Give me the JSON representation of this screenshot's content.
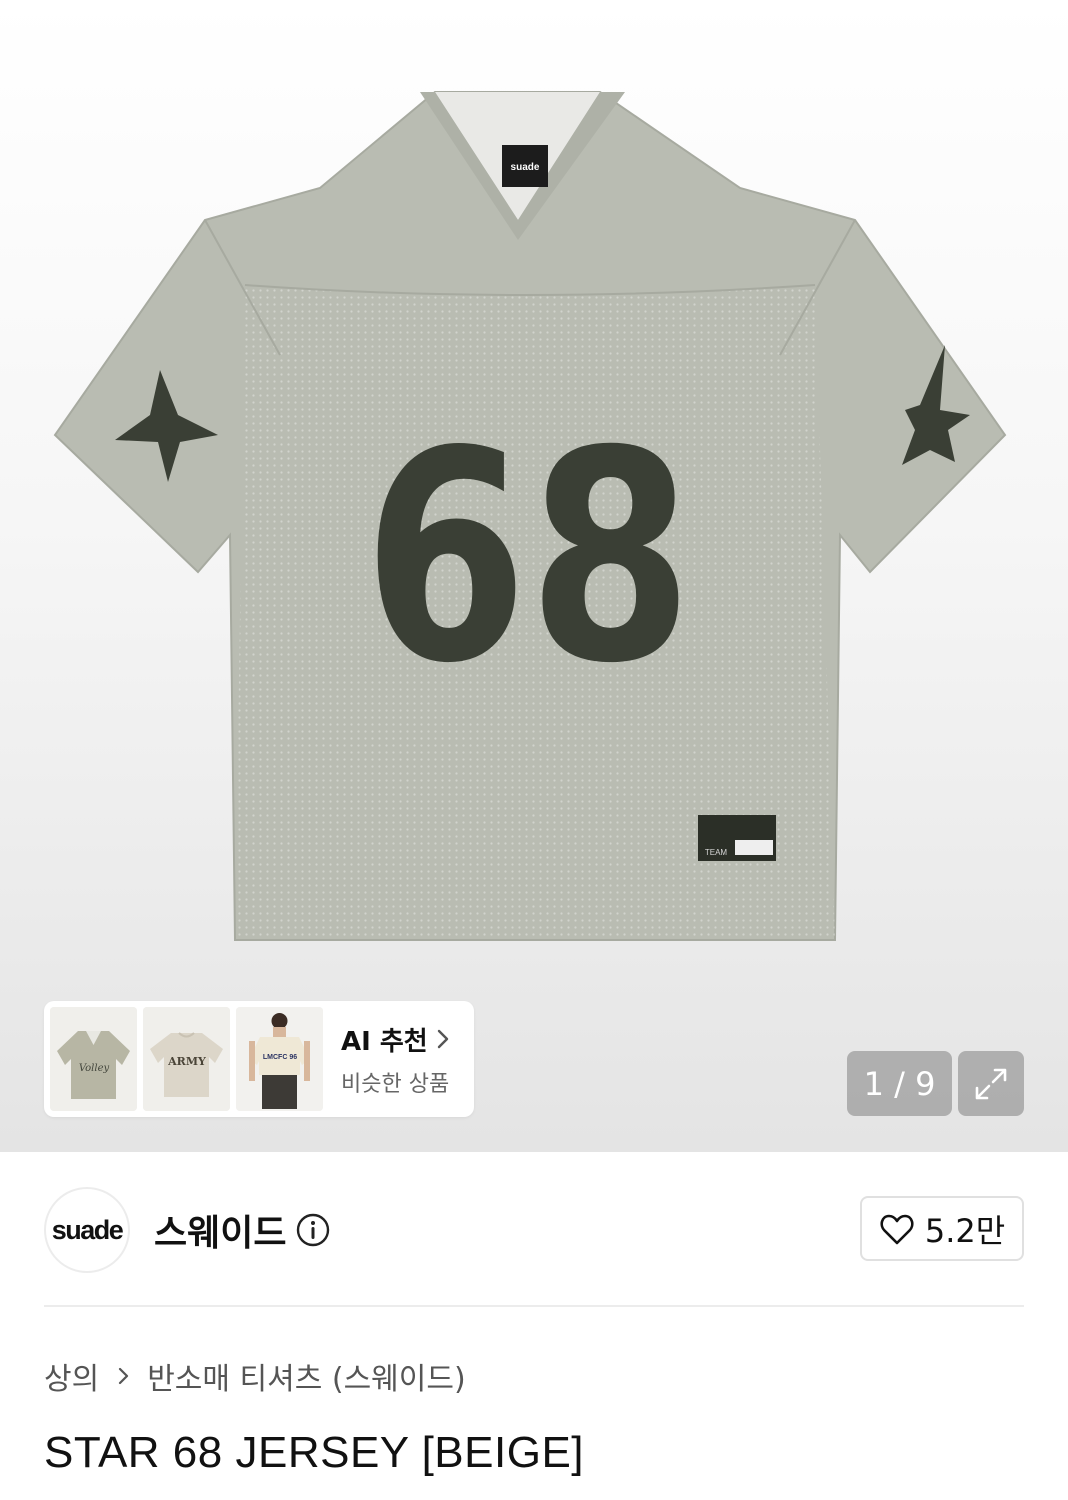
{
  "gallery": {
    "image_name": "jersey-image",
    "jersey_number": "68",
    "collar_label": "suade",
    "hem_label": "TEAM",
    "counter": "1 / 9",
    "thumbnails": [
      {
        "name": "thumbnail-1",
        "text": "Volley"
      },
      {
        "name": "thumbnail-2",
        "text": "ARMY"
      },
      {
        "name": "thumbnail-3",
        "text": "LMCFC 96"
      }
    ],
    "ai_recommend": {
      "title": "AI 추천",
      "subtitle": "비슷한 상품"
    },
    "icons": [
      "chevron-right-icon",
      "expand-icon"
    ]
  },
  "brand": {
    "logo_text": "suade",
    "name": "스웨이드",
    "icons": [
      "info-icon"
    ]
  },
  "like": {
    "count": "5.2만",
    "icon": "heart-outline-icon"
  },
  "breadcrumb": {
    "level1": "상의",
    "level2": "반소매 티셔츠 (스웨이드)",
    "icon": "chevron-right-icon"
  },
  "product": {
    "title": "STAR 68 JERSEY [BEIGE]"
  },
  "colors": {
    "jersey": "#b9bcb2",
    "jersey_shadow": "#a7aaa0",
    "number": "#3a3f35",
    "counter_bg": "#8a8a8a",
    "border": "#e0e0e0"
  }
}
